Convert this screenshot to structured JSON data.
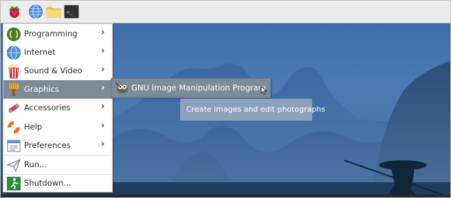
{
  "taskbar": {
    "icons": [
      "raspberry-menu-icon",
      "web-browser-icon",
      "file-manager-icon",
      "terminal-icon"
    ]
  },
  "menu": {
    "items": [
      {
        "label": "Programming",
        "has_submenu": true,
        "icon": "programming-icon"
      },
      {
        "label": "Internet",
        "has_submenu": true,
        "icon": "globe-icon"
      },
      {
        "label": "Sound & Video",
        "has_submenu": true,
        "icon": "popcorn-icon"
      },
      {
        "label": "Graphics",
        "has_submenu": true,
        "selected": true,
        "icon": "paintbrush-icon"
      },
      {
        "label": "Accessories",
        "has_submenu": true,
        "icon": "accessories-icon"
      },
      {
        "label": "Help",
        "has_submenu": true,
        "icon": "lifebuoy-icon"
      },
      {
        "label": "Preferences",
        "has_submenu": true,
        "icon": "preferences-icon"
      },
      {
        "label": "Run...",
        "has_submenu": false,
        "icon": "paper-plane-icon"
      },
      {
        "label": "Shutdown...",
        "has_submenu": false,
        "icon": "exit-icon"
      }
    ],
    "arrow": "›"
  },
  "submenu": {
    "item": {
      "label": "GNU Image Manipulation Program",
      "icon": "gimp-icon"
    }
  },
  "tooltip": {
    "text": "Create images and edit photographs"
  },
  "colors": {
    "selection": "#7d8a98",
    "taskbar": "#ececec",
    "desktop_sky": "#4777b0"
  }
}
